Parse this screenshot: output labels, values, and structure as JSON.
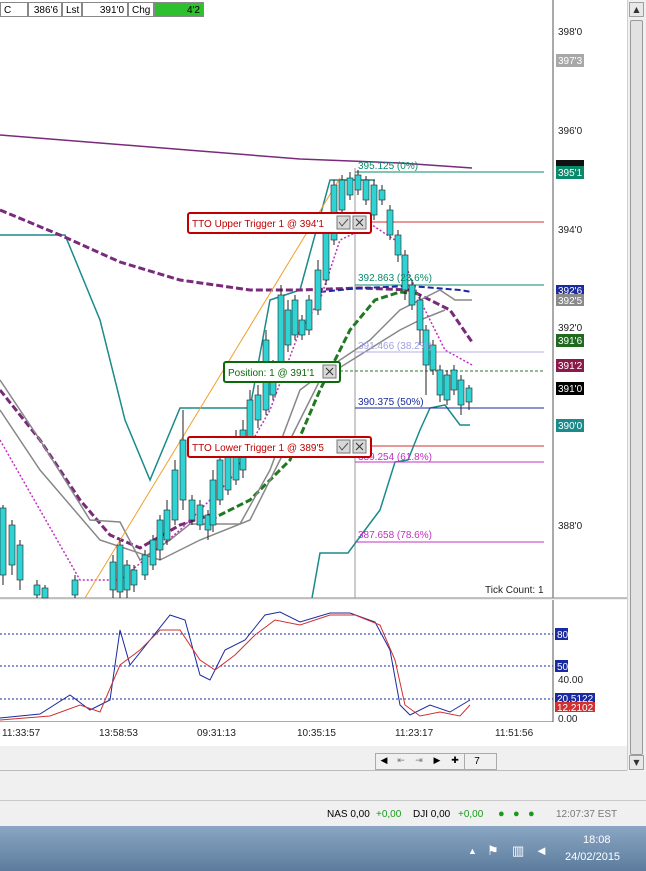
{
  "quote": {
    "c_label": "C",
    "c_value": "386'6",
    "lst_label": "Lst",
    "lst_value": "391'0",
    "chg_label": "Chg",
    "chg_value": "4'2"
  },
  "price_axis": {
    "labels": [
      "398'0",
      "396'0",
      "394'0",
      "392'0",
      "388'0"
    ],
    "tags": {
      "t3973": "397'3",
      "t3951": "395'1",
      "t3926": "392'6",
      "t3925": "392'5",
      "t3916": "391'6",
      "t3912": "391'2",
      "t3910": "391'0",
      "t3900": "390'0"
    }
  },
  "fib": {
    "l0": "395.125 (0%)",
    "l236": "392.863 (23.6%)",
    "l382": "391.466 (38.2%)",
    "l50": "390.375 (50%)",
    "l618": "389.254 (61.8%)",
    "l786": "387.658 (78.6%)"
  },
  "orders": {
    "upper": "TTO Upper Trigger 1 @ 394'1",
    "position": "Position: 1 @ 391'1",
    "lower": "TTO Lower Trigger 1 @ 389'5"
  },
  "tick_count": "Tick Count:  1",
  "osc_axis": {
    "l80": "80.00",
    "l50": "50",
    "l40": "40.00",
    "l20": "20.5122",
    "l12": "12.2102",
    "l0": "0.00"
  },
  "time_labels": [
    "11:33:57",
    "13:58:53",
    "09:31:13",
    "10:35:15",
    "11:23:17",
    "11:51:56"
  ],
  "tab_label": "7",
  "status": {
    "nas": "NAS 0,00",
    "nas_chg": "+0,00",
    "dji": "DJI 0,00",
    "dji_chg": "+0,00",
    "time": "12:07:37 EST"
  },
  "clock": {
    "time": "18:08",
    "date": "24/02/2015"
  },
  "colors": {
    "up": "#2fd3d3",
    "down": "#d81818",
    "fib": "#0a8a6a",
    "order_red": "#c00000",
    "order_green": "#0a6a0a"
  }
}
